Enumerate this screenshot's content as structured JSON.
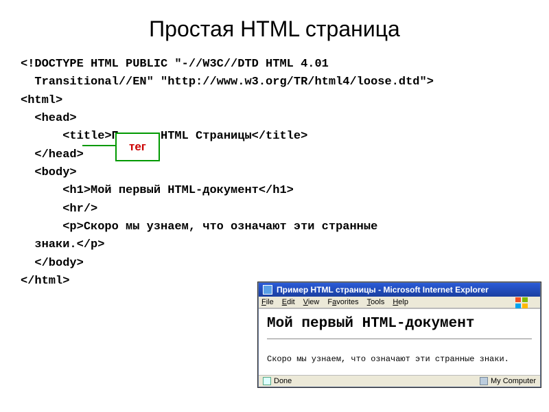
{
  "title": "Простая HTML страница",
  "code": {
    "l1": "<!DOCTYPE HTML PUBLIC \"-//W3C//DTD HTML 4.01\n  Transitional//EN\" \"http://www.w3.org/TR/html4/loose.dtd\">",
    "l2": "<html>",
    "l3": "  <head>",
    "l4": "      <title>Пример HTML Страницы</title>",
    "l5": "  </head>",
    "l6": "  <body>",
    "l7": "      <h1>Мой первый HTML-документ</h1>",
    "l8": "      <hr/>",
    "l9": "      <p>Скоро мы узнаем, что означают эти странные\n  знаки.</p>",
    "l10": "  </body>",
    "l11": "</html>"
  },
  "callout": {
    "label": "тег"
  },
  "browser": {
    "title": "Пример HTML страницы - Microsoft Internet Explorer",
    "menu": {
      "file": "File",
      "edit": "Edit",
      "view": "View",
      "favorites": "Favorites",
      "tools": "Tools",
      "help": "Help"
    },
    "content": {
      "h1": "Мой первый HTML-документ",
      "p": "Скоро мы узнаем, что означают эти странные знаки."
    },
    "status": {
      "done": "Done",
      "zone": "My Computer"
    }
  }
}
